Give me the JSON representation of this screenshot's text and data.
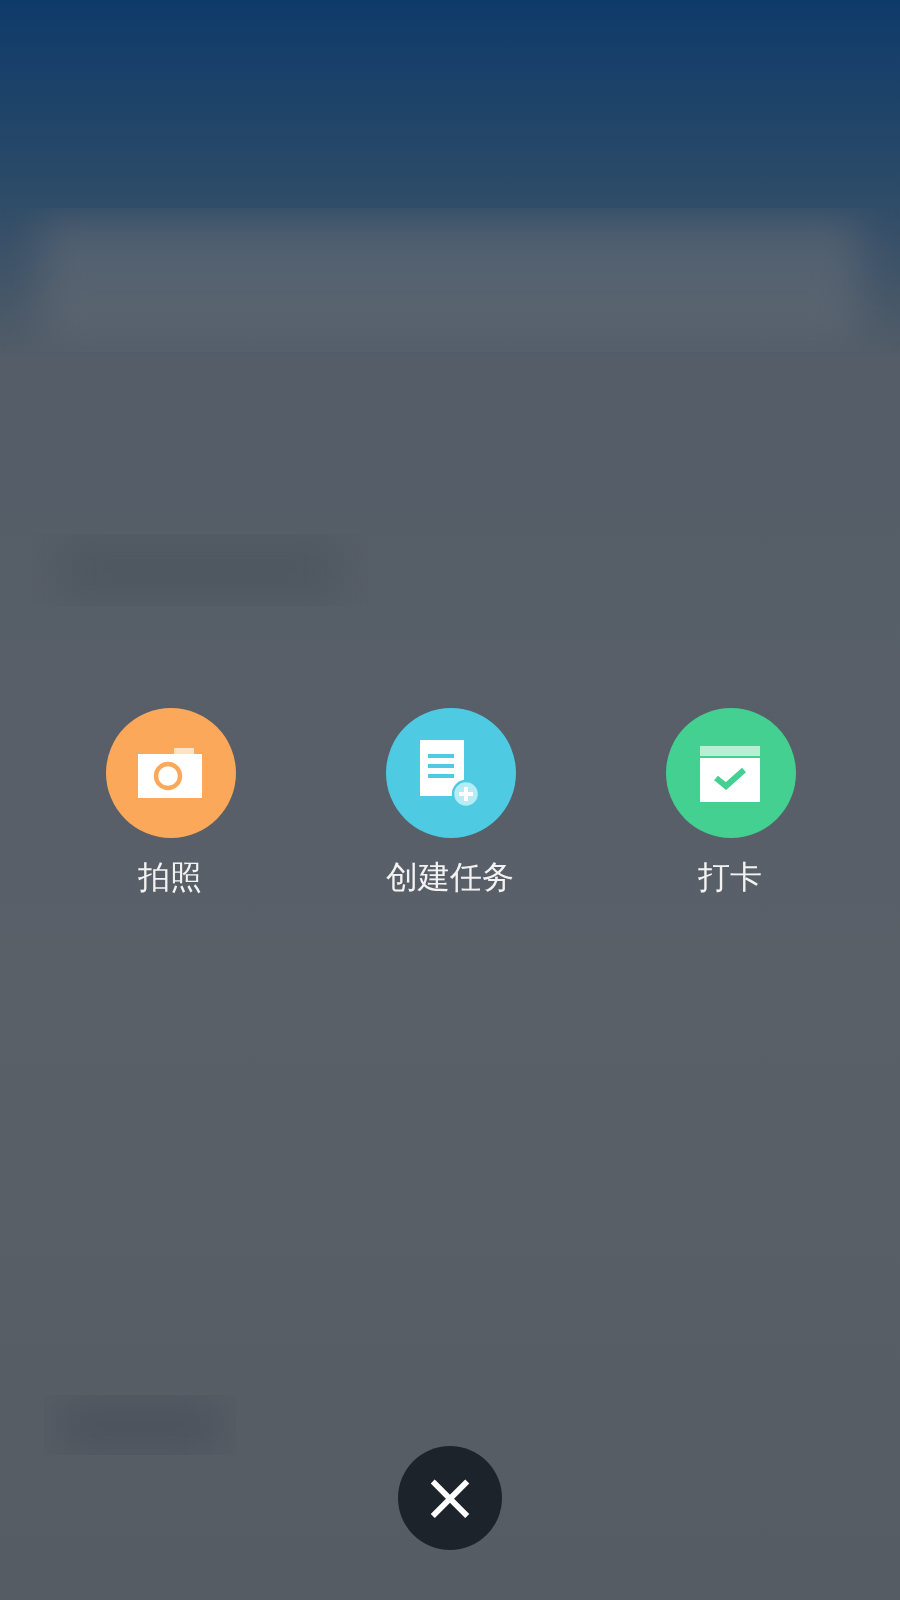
{
  "actions": [
    {
      "kind": "camera",
      "label": "拍照",
      "color": "#fba85a"
    },
    {
      "kind": "task",
      "label": "创建任务",
      "color": "#4ecbe3"
    },
    {
      "kind": "checkin",
      "label": "打卡",
      "color": "#44d091"
    }
  ],
  "close_button": {
    "label": "×"
  }
}
